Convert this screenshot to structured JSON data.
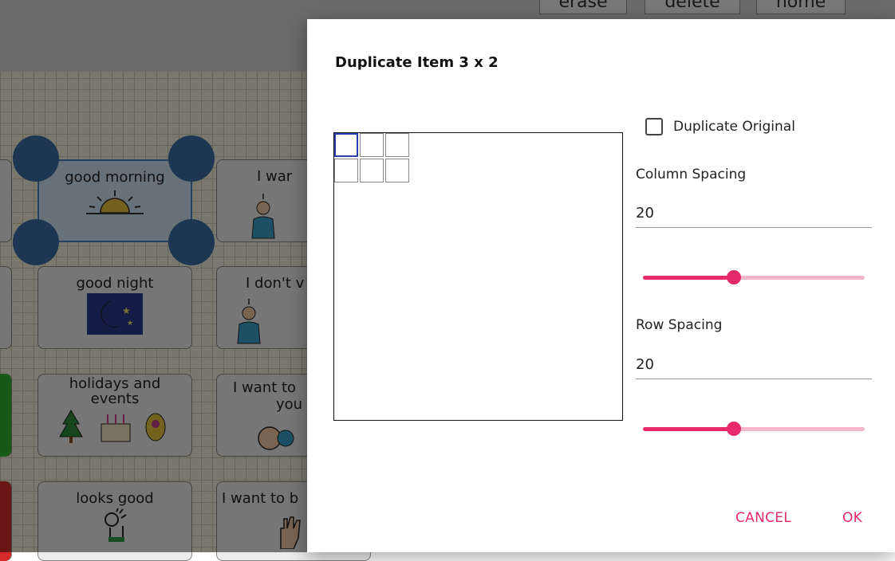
{
  "background": {
    "topbar": {
      "erase": "erase",
      "delete": "delete",
      "home": "home"
    },
    "cells": {
      "good_morning": "good morning",
      "i_want": "I war",
      "good_night": "good night",
      "i_dont": "I don't v",
      "holidays": "holidays and events",
      "i_want_to": "I want to",
      "you": "you",
      "looks_good": "looks good",
      "i_want_to_be": "I want to b"
    },
    "colors": {
      "green_tab": "#2fb52f",
      "red_tab": "#d42a2a"
    }
  },
  "dialog": {
    "title": "Duplicate Item 3 x 2",
    "preview": {
      "columns": 3,
      "rows": 2
    },
    "duplicate_original": {
      "label": "Duplicate Original",
      "checked": false
    },
    "column_spacing": {
      "label": "Column Spacing",
      "value": "20",
      "slider_fraction": 0.41
    },
    "row_spacing": {
      "label": "Row Spacing",
      "value": "20",
      "slider_fraction": 0.41
    },
    "buttons": {
      "cancel": "CANCEL",
      "ok": "OK"
    },
    "accent_color": "#e62a6b"
  }
}
